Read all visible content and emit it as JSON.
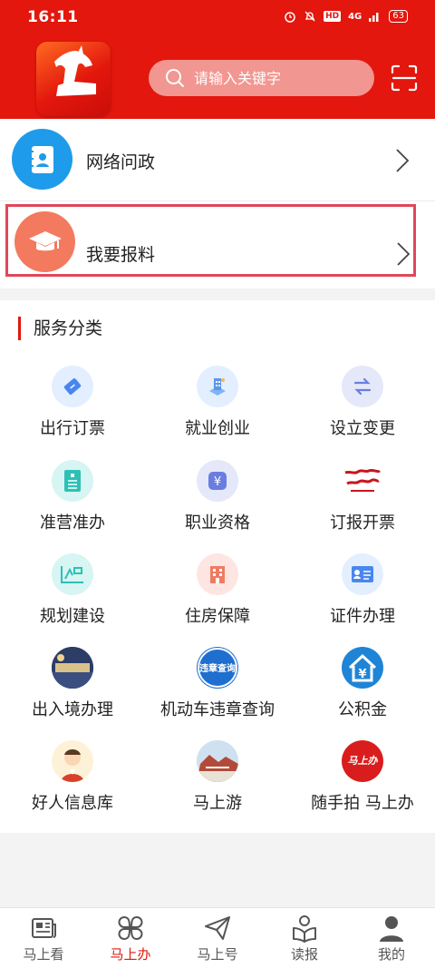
{
  "status": {
    "time": "16:11",
    "hd": "HD",
    "signal": "4G",
    "battery": "63"
  },
  "search": {
    "placeholder": "请输入关键字"
  },
  "rows": [
    {
      "label": "网络问政",
      "icon": "contacts-book-icon"
    },
    {
      "label": "我要报料",
      "icon": "graduation-cap-icon"
    }
  ],
  "services": {
    "title": "服务分类",
    "items": [
      {
        "label": "出行订票",
        "icon": "ticket-icon"
      },
      {
        "label": "就业创业",
        "icon": "building-icon"
      },
      {
        "label": "设立变更",
        "icon": "swap-arrows-icon"
      },
      {
        "label": "准营准办",
        "icon": "document-icon"
      },
      {
        "label": "职业资格",
        "icon": "yuan-icon"
      },
      {
        "label": "订报开票",
        "icon": "calligraphy-icon"
      },
      {
        "label": "规划建设",
        "icon": "blueprint-icon"
      },
      {
        "label": "住房保障",
        "icon": "apartment-icon"
      },
      {
        "label": "证件办理",
        "icon": "id-card-icon"
      },
      {
        "label": "出入境办理",
        "icon": "immigration-photo-icon"
      },
      {
        "label": "机动车违章查询",
        "icon": "traffic-violation-icon"
      },
      {
        "label": "公积金",
        "icon": "housing-fund-icon"
      },
      {
        "label": "好人信息库",
        "icon": "person-avatar-icon"
      },
      {
        "label": "马上游",
        "icon": "travel-photo-icon"
      },
      {
        "label": "随手拍 马上办",
        "icon": "snap-logo-icon"
      }
    ],
    "badge_texts": {
      "traffic": "违章查询",
      "snap": "马上办"
    }
  },
  "nav": {
    "tabs": [
      {
        "label": "马上看",
        "icon": "newspaper-icon",
        "active": false
      },
      {
        "label": "马上办",
        "icon": "clover-grid-icon",
        "active": true
      },
      {
        "label": "马上号",
        "icon": "paper-plane-icon",
        "active": false
      },
      {
        "label": "读报",
        "icon": "reading-person-icon",
        "active": false
      },
      {
        "label": "我的",
        "icon": "user-icon",
        "active": false
      }
    ]
  },
  "colors": {
    "brand": "#e3170d",
    "highlight_border": "#e0475a"
  }
}
